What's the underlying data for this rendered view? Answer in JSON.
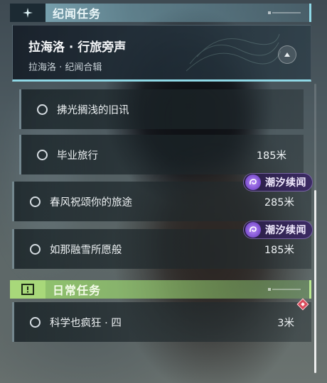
{
  "world_quests": {
    "header": {
      "title": "纪闻任务",
      "icon": "sparkle-icon"
    },
    "active_quest": {
      "title": "拉海洛 · 行旅旁声",
      "subtitle": "拉海洛 · 纪闻合辑",
      "collapse_icon": "chevron-up-icon"
    },
    "items": [
      {
        "name": "拂光搁浅的旧讯",
        "distance": "",
        "tracked": false,
        "tag": ""
      },
      {
        "name": "毕业旅行",
        "distance": "185米",
        "tracked": false,
        "tag": ""
      },
      {
        "name": "春风祝颂你的旅途",
        "distance": "285米",
        "tracked": false,
        "tag": "潮汐续闻"
      },
      {
        "name": "如那融雪所愿般",
        "distance": "185米",
        "tracked": false,
        "tag": "潮汐续闻"
      }
    ]
  },
  "daily_quests": {
    "header": {
      "title": "日常任务",
      "icon": "alert-box-icon"
    },
    "items": [
      {
        "name": "科学也疯狂 · 四",
        "distance": "3米",
        "tracked": false,
        "marker": "red-diamond-marker-icon"
      }
    ]
  },
  "colors": {
    "world_accent": "#8fd8e6",
    "daily_accent": "#a8d87a",
    "tide_badge": "#7d4fd0",
    "marker": "#d94a5a"
  }
}
